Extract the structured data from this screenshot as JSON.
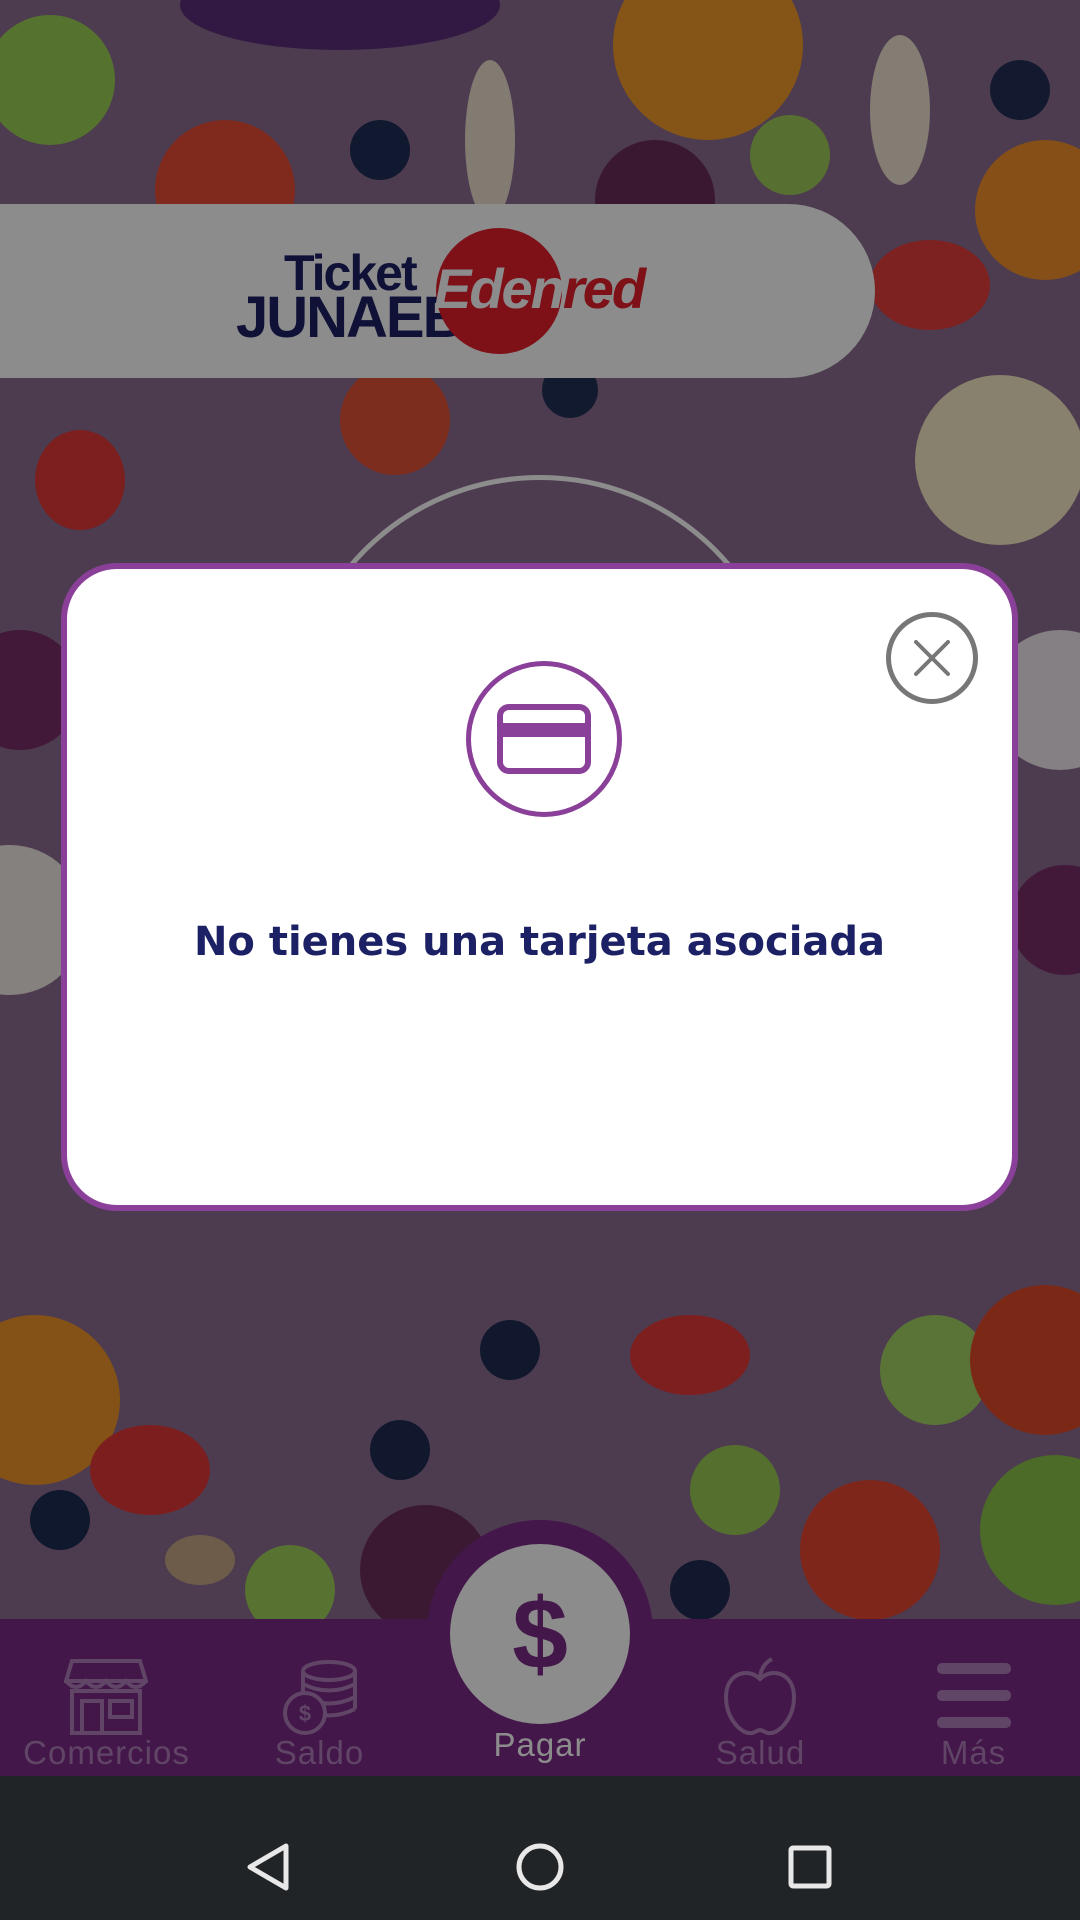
{
  "header": {
    "logo_ticket": "Ticket",
    "logo_junaeb": "JUNAEB",
    "logo_edenred_main": "Eden",
    "logo_edenred_tail": "red"
  },
  "modal": {
    "message": "No tienes una tarjeta asociada",
    "close_icon": "close-icon",
    "card_icon": "credit-card-icon"
  },
  "bottom_nav": {
    "items": [
      {
        "label": "Comercios",
        "icon": "store-icon"
      },
      {
        "label": "Saldo",
        "icon": "coins-icon"
      },
      {
        "label": "Pagar",
        "icon": "dollar-icon",
        "symbol": "$"
      },
      {
        "label": "Salud",
        "icon": "apple-icon"
      },
      {
        "label": "Más",
        "icon": "menu-icon"
      }
    ]
  },
  "system_nav": {
    "back": "back-icon",
    "home": "home-icon",
    "recents": "recents-icon"
  },
  "colors": {
    "brand_purple": "#7b2a87",
    "modal_border": "#8a3f99",
    "text_navy": "#1c2064",
    "edenred_red": "#e41f2a"
  }
}
